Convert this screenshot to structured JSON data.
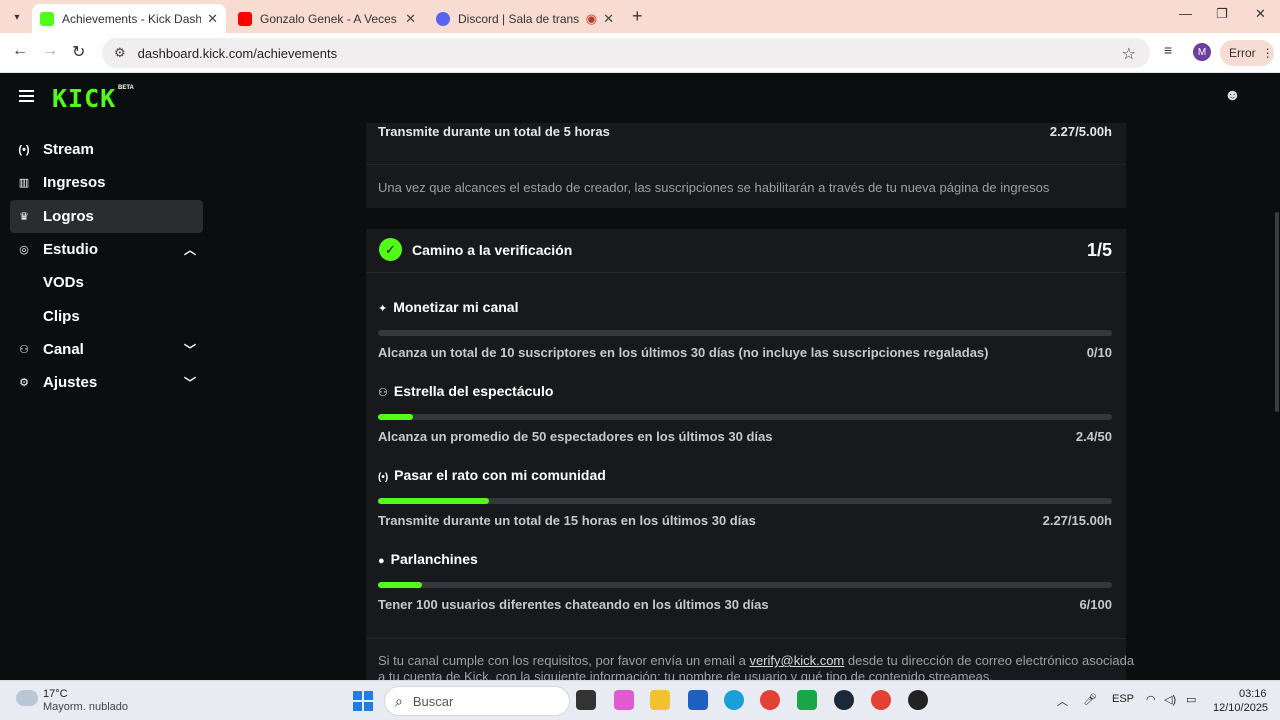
{
  "browser": {
    "tabs": [
      {
        "title": "Achievements - Kick Dashboard",
        "active": true,
        "favicon": "kick-favicon",
        "color": "#53fc18"
      },
      {
        "title": "Gonzalo Genek - A Veces (Aud",
        "active": false,
        "favicon": "youtube-favicon",
        "color": "#ff0000"
      },
      {
        "title": "Discord | Sala de transmisió",
        "active": false,
        "favicon": "discord-favicon",
        "color": "#5865f2"
      }
    ],
    "url": "dashboard.kick.com/achievements",
    "profile_initial": "M",
    "error_label": "Error"
  },
  "kick": {
    "logo": "KICK",
    "beta": "BETA",
    "brand_color": "#53fc18"
  },
  "sidebar": {
    "items": [
      {
        "label": "Stream",
        "icon": "broadcast-icon"
      },
      {
        "label": "Ingresos",
        "icon": "chart-icon"
      },
      {
        "label": "Logros",
        "icon": "trophy-icon",
        "active": true
      },
      {
        "label": "Estudio",
        "icon": "studio-icon",
        "expanded": true
      },
      {
        "label": "VODs"
      },
      {
        "label": "Clips"
      },
      {
        "label": "Canal",
        "icon": "users-icon",
        "expanded": false
      },
      {
        "label": "Ajustes",
        "icon": "gear-icon",
        "expanded": false
      }
    ]
  },
  "top_card": {
    "requirement": "Transmite durante un total de 5 horas",
    "progress": "2.27/5.00h",
    "note": "Una vez que alcances el estado de creador, las suscripciones se habilitarán a través de tu nueva página de ingresos"
  },
  "verification": {
    "title": "Camino a la verificación",
    "count": "1/5",
    "goals": [
      {
        "title": "Monetizar mi canal",
        "icon": "sparkle-icon",
        "desc": "Alcanza un total de 10 suscriptores en los últimos 30 días (no incluye las suscripciones regaladas)",
        "progress": "0/10",
        "fraction": 0.0
      },
      {
        "title": "Estrella del espectáculo",
        "icon": "viewers-icon",
        "desc": "Alcanza un promedio de 50 espectadores en los últimos 30 días",
        "progress": "2.4/50",
        "fraction": 0.048
      },
      {
        "title": "Pasar el rato con mi comunidad",
        "icon": "broadcast-icon",
        "desc": "Transmite durante un total de 15 horas en los últimos 30 días",
        "progress": "2.27/15.00h",
        "fraction": 0.151
      },
      {
        "title": "Parlanchines",
        "icon": "chat-icon",
        "desc": "Tener 100 usuarios diferentes chateando en los últimos 30 días",
        "progress": "6/100",
        "fraction": 0.06
      }
    ],
    "footer_pre": "Si tu canal cumple con los requisitos, por favor envía un email a",
    "footer_email": "verify@kick.com",
    "footer_post": "desde tu dirección de correo electrónico asociada",
    "footer_line2": "a tu cuenta de Kick, con la siguiente información: tu nombre de usuario y qué tipo de contenido streameas."
  },
  "taskbar": {
    "temp": "17°C",
    "weather": "Mayorm. nublado",
    "search": "Buscar",
    "lang": "ESP",
    "time": "03:16",
    "date": "12/10/2025"
  }
}
